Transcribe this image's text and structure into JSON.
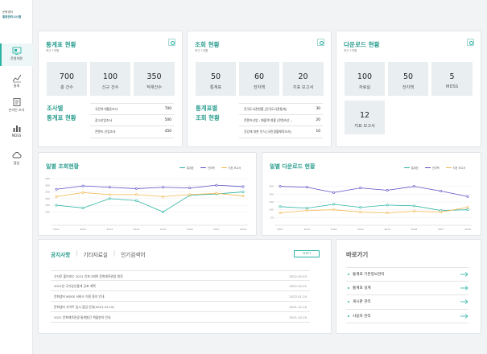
{
  "logo": {
    "line1": "문화셈터",
    "line2": "통합관리시스템"
  },
  "nav": [
    {
      "label": "운영지원",
      "icon": "dashboard-icon",
      "active": true
    },
    {
      "label": "통계",
      "icon": "line-chart-icon"
    },
    {
      "label": "온라인 조사",
      "icon": "survey-icon"
    },
    {
      "label": "MDSS",
      "icon": "bar-chart-icon"
    },
    {
      "label": "협업",
      "icon": "cloud-icon"
    }
  ],
  "stats_card": {
    "title": "통계표 현황",
    "subtitle": "최근 1개월",
    "boxes": [
      {
        "num": "700",
        "label": "총 건수"
      },
      {
        "num": "100",
        "label": "신규 건수"
      },
      {
        "num": "350",
        "label": "적재건수"
      }
    ],
    "sub_title_1": "조사별",
    "sub_title_2": "통계표 현황",
    "rows": [
      {
        "name": "국민여가활동조사",
        "value": "700"
      },
      {
        "name": "광고산업조사",
        "value": "500"
      },
      {
        "name": "콘텐츠 산업조사",
        "value": "450"
      }
    ]
  },
  "views_card": {
    "title": "조회 현황",
    "subtitle": "최근 1개월",
    "boxes": [
      {
        "num": "50",
        "label": "통계표"
      },
      {
        "num": "60",
        "label": "전자책"
      },
      {
        "num": "20",
        "label": "지표 보고서"
      }
    ],
    "sub_title_1": "통계표별",
    "sub_title_2": "조회 현황",
    "rows": [
      {
        "name": "전국도서관현황 [전국도서관통계]",
        "value": "30"
      },
      {
        "name": "콘텐츠산업 : 매출액 현황 [콘텐츠산...",
        "value": "20"
      },
      {
        "name": "건강에 대한 인식 [국민생활체육조사]",
        "value": "10"
      }
    ]
  },
  "downloads_card": {
    "title": "다운로드 현황",
    "subtitle": "최근 1개월",
    "boxes": [
      {
        "num": "100",
        "label": "자료실"
      },
      {
        "num": "50",
        "label": "전자책"
      },
      {
        "num": "5",
        "label": "MDSS"
      },
      {
        "num": "12",
        "label": "지표 보고서"
      }
    ]
  },
  "colors": {
    "teal": "#2bb3a3",
    "purple": "#5b4fc4",
    "orange": "#f2b64c"
  },
  "chart_data": [
    {
      "type": "line",
      "title": "일별 조회현황",
      "x": [
        "2011",
        "2012",
        "2013",
        "2014",
        "2015",
        "2016",
        "2017",
        "2018"
      ],
      "ylim": [
        0,
        350
      ],
      "yticks": [
        "100",
        "150",
        "200",
        "250",
        "300",
        "350"
      ],
      "series": [
        {
          "name": "통계표",
          "color": "#2bb3a3",
          "values": [
            150,
            130,
            200,
            185,
            100,
            225,
            235,
            250
          ]
        },
        {
          "name": "전자책",
          "color": "#5b4fc4",
          "values": [
            270,
            295,
            285,
            275,
            285,
            280,
            300,
            290
          ]
        },
        {
          "name": "지표 보고서",
          "color": "#f2b64c",
          "values": [
            215,
            245,
            230,
            230,
            215,
            230,
            240,
            220
          ]
        }
      ]
    },
    {
      "type": "line",
      "title": "일별 다운로드 현황",
      "x": [
        "2011",
        "2012",
        "2013",
        "2014",
        "2015",
        "2016",
        "2017",
        "2018"
      ],
      "ylim": [
        0,
        300
      ],
      "yticks": [
        "50",
        "100",
        "150",
        "200",
        "250"
      ],
      "series": [
        {
          "name": "통계표",
          "color": "#2bb3a3",
          "values": [
            120,
            110,
            135,
            115,
            130,
            125,
            95,
            100
          ]
        },
        {
          "name": "전자책",
          "color": "#5b4fc4",
          "values": [
            250,
            245,
            210,
            240,
            225,
            250,
            220,
            185
          ]
        },
        {
          "name": "지표 보고서",
          "color": "#f2b64c",
          "values": [
            80,
            95,
            100,
            85,
            80,
            90,
            85,
            115
          ]
        }
      ]
    }
  ],
  "notice": {
    "tabs": [
      "공지사항",
      "기타자료실",
      "인기검색어"
    ],
    "more": "더보기",
    "rows": [
      {
        "title": "숫자로 풀어보는 2021 인포그래픽 문화체육관광 발전",
        "date": "2022.02.03"
      },
      {
        "title": "2022년 국가승인통계 공표 계획",
        "date": "2022.02.01"
      },
      {
        "title": "문화셈터 MDSS 서비스 이용 중지 안내",
        "date": "2022.01.20"
      },
      {
        "title": "문화셈터 사이트 임시 점검 안내(2021.12.15)",
        "date": "2021.12.10"
      },
      {
        "title": "2021 문화체육관광 통계발간 책출판의 안내",
        "date": "2021.10.10"
      }
    ]
  },
  "quick": {
    "title": "바로가기",
    "items": [
      "통계표 기본정보관리",
      "통계표 설계",
      "게시판 관리",
      "사용자 관리"
    ]
  }
}
